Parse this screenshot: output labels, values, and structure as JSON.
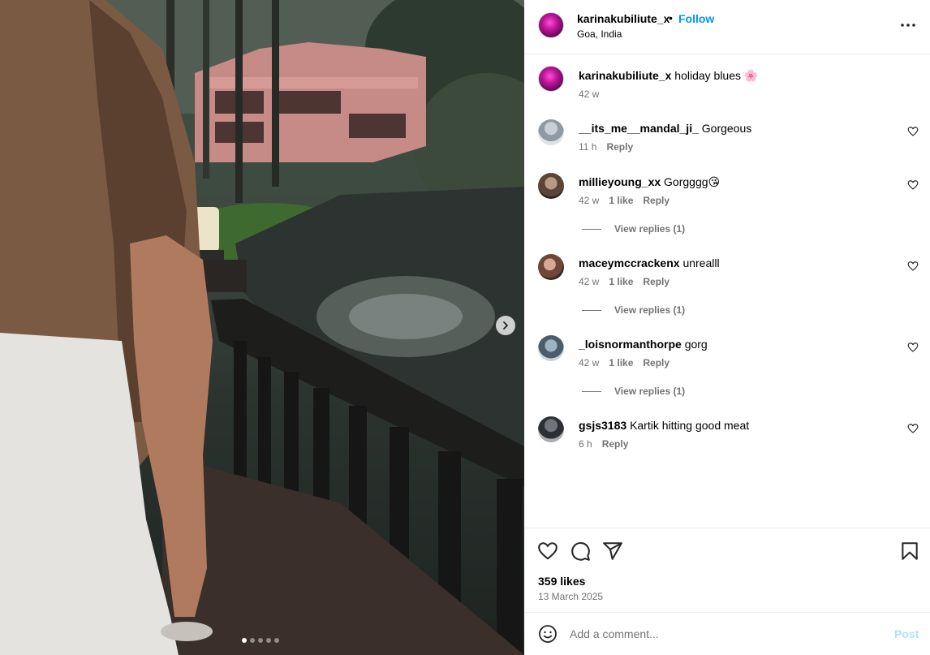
{
  "post": {
    "username": "karinakubiliute_x",
    "separator": "•",
    "follow_label": "Follow",
    "location": "Goa, India",
    "more_icon": "more-horizontal-icon"
  },
  "media": {
    "next_icon": "chevron-right-icon",
    "slide_count": 5,
    "active_slide": 1
  },
  "caption": {
    "username": "karinakubiliute_x",
    "text": "holiday blues 🌸",
    "time": "42 w"
  },
  "comments": [
    {
      "username": "__its_me__mandal_ji_",
      "text": "Gorgeous",
      "time": "11 h",
      "likes": "",
      "reply_label": "Reply",
      "view_replies": ""
    },
    {
      "username": "millieyoung_xx",
      "text": "Gorgggg😘",
      "time": "42 w",
      "likes": "1 like",
      "reply_label": "Reply",
      "view_replies": "View replies (1)"
    },
    {
      "username": "maceymccrackenx",
      "text": "unrealll",
      "time": "42 w",
      "likes": "1 like",
      "reply_label": "Reply",
      "view_replies": "View replies (1)"
    },
    {
      "username": "_loisnormanthorpe",
      "text": "gorg",
      "time": "42 w",
      "likes": "1 like",
      "reply_label": "Reply",
      "view_replies": "View replies (1)"
    },
    {
      "username": "gsjs3183",
      "text": "Kartik hitting good meat",
      "time": "6 h",
      "likes": "",
      "reply_label": "Reply",
      "view_replies": ""
    }
  ],
  "actions": {
    "like_icon": "heart-icon",
    "comment_icon": "comment-bubble-icon",
    "share_icon": "share-paper-plane-icon",
    "save_icon": "bookmark-icon",
    "likes_text": "359 likes",
    "date_text": "13 March 2025"
  },
  "add_comment": {
    "emoji_icon": "emoji-smile-icon",
    "placeholder": "Add a comment...",
    "post_label": "Post"
  },
  "colors": {
    "accent": "#0095f6",
    "muted_text": "#737373",
    "post_disabled": "#b2dffc",
    "divider": "#efefef"
  }
}
